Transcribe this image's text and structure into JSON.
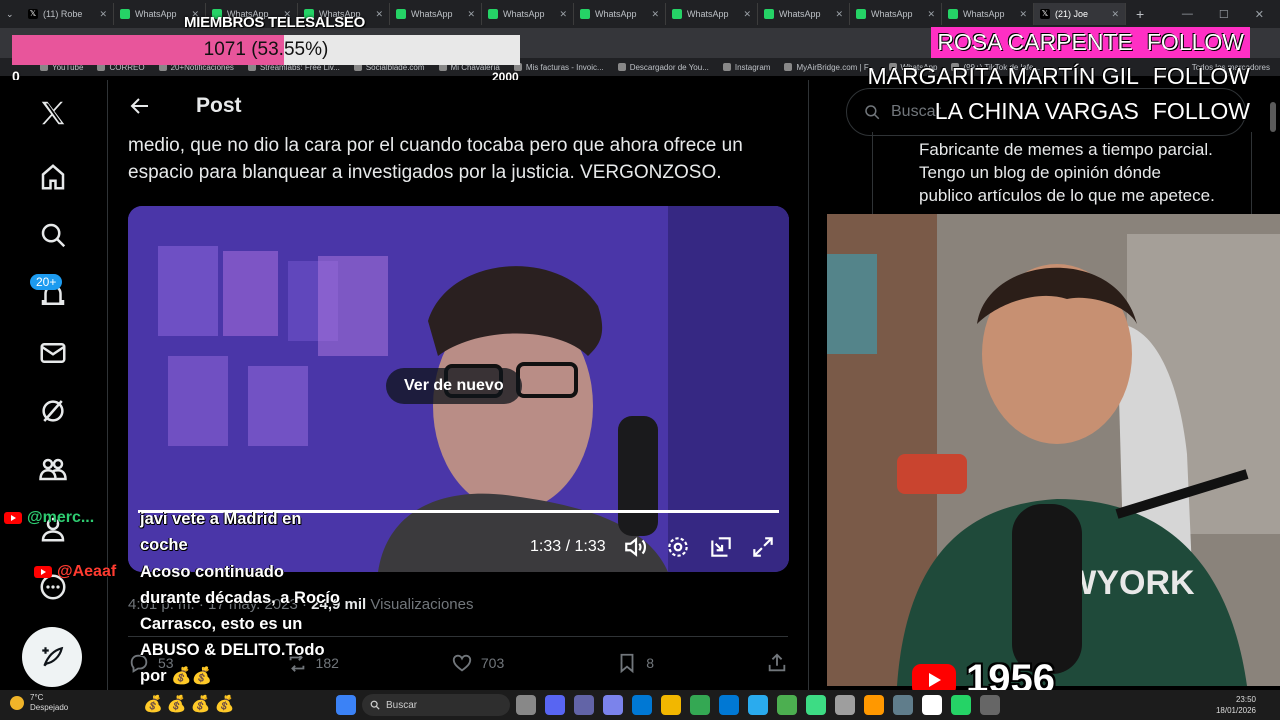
{
  "browser": {
    "tabs": [
      {
        "label": "(11) Robe",
        "icon": "x"
      },
      {
        "label": "WhatsApp",
        "icon": "whatsapp"
      },
      {
        "label": "WhatsApp",
        "icon": "whatsapp"
      },
      {
        "label": "WhatsApp",
        "icon": "whatsapp"
      },
      {
        "label": "WhatsApp",
        "icon": "whatsapp"
      },
      {
        "label": "WhatsApp",
        "icon": "whatsapp"
      },
      {
        "label": "WhatsApp",
        "icon": "whatsapp"
      },
      {
        "label": "WhatsApp",
        "icon": "whatsapp"
      },
      {
        "label": "WhatsApp",
        "icon": "whatsapp"
      },
      {
        "label": "WhatsApp",
        "icon": "whatsapp"
      },
      {
        "label": "WhatsApp",
        "icon": "whatsapp"
      },
      {
        "label": "(21) Joe",
        "icon": "x"
      }
    ],
    "bookmarks": [
      "YouTube",
      "CORREO",
      "20+Notificaciones",
      "Streamlabs: Free Liv...",
      "Socialblade.com",
      "Mi Chavalería",
      "Mis facturas - Invoic...",
      "Descargador de You...",
      "Instagram",
      "MyAirBridge.com | F...",
      "WhatsApp",
      "(99+) TikTok de lafe..."
    ],
    "bookmarks_other": "Todos los marcadores"
  },
  "overlay": {
    "members_title": "MIEMBROS TELESALSEO",
    "members_bar_text": "1071 (53.55%)",
    "members_progress": 0.5355,
    "members_min": "0",
    "members_max": "2000",
    "follows": [
      {
        "name": "ROSA CARPENTE",
        "action": "FOLLOW"
      },
      {
        "name": "MARGARITA MARTÍN GIL",
        "action": "FOLLOW"
      },
      {
        "name": "LA CHINA VARGAS",
        "action": "FOLLOW"
      }
    ],
    "subscriber_count": "1956"
  },
  "nav": {
    "notifications_badge": "20+"
  },
  "post": {
    "header_title": "Post",
    "text": "medio, que no dio la cara por el cuando tocaba pero que ahora ofrece un espacio para blanquear a investigados por la justicia. VERGONZOSO.",
    "video": {
      "replay_label": "Ver de nuevo",
      "time": "1:33 / 1:33",
      "progress": 1.0
    },
    "meta_time": "4:01 p. m. · 17 may. 2023 · ",
    "views_count": "24,9 mil",
    "views_label": "Visualizaciones",
    "stats": {
      "replies": "53",
      "reposts": "182",
      "likes": "703",
      "bookmarks": "8"
    }
  },
  "sidebar": {
    "search_placeholder": "Buscar",
    "bio_lines": [
      "Fabricante de memes a tiempo parcial.",
      "Tengo un blog de opinión dónde",
      "publico artículos de lo que me apetece."
    ]
  },
  "chat": {
    "user1": "@merc...",
    "user2": "@Aeaaf",
    "message1": "javi vete a Madrid en coche",
    "message2": "Acoso continuado durante décadas, a Rocío Carrasco, esto es un ABUSO & DELITO.Todo por 💰💰"
  },
  "taskbar": {
    "temperature": "7°C",
    "weather": "Despejado",
    "search": "Buscar",
    "time": "23:50",
    "date": "18/01/2026",
    "emoji_bags": "💰💰💰💰"
  },
  "colors": {
    "x_bg": "#000000",
    "x_text": "#e7e9ea",
    "x_muted": "#71767b",
    "x_blue": "#1d9bf0",
    "bar_pink": "#e8559b",
    "follow_pink": "#ff2fc4"
  }
}
